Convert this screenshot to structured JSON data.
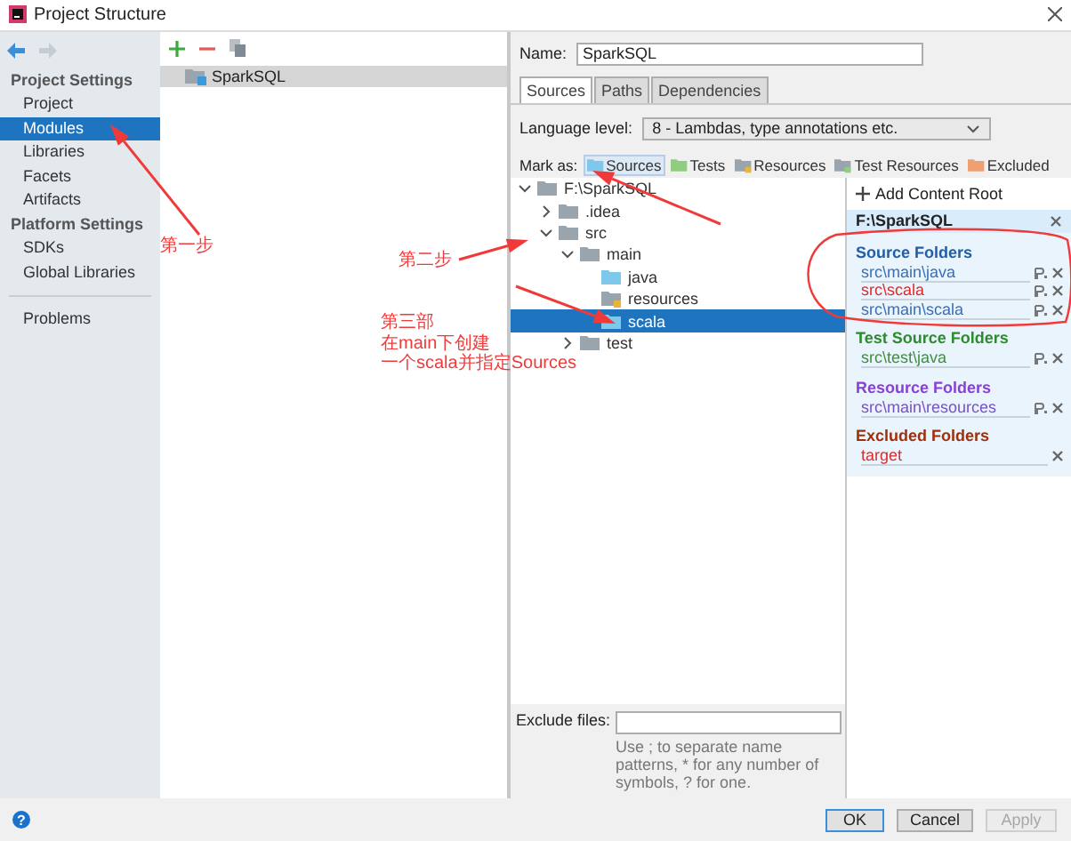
{
  "window": {
    "title": "Project Structure"
  },
  "sidebar": {
    "sections": [
      {
        "heading": "Project Settings",
        "items": [
          {
            "label": "Project",
            "selected": false
          },
          {
            "label": "Modules",
            "selected": true
          },
          {
            "label": "Libraries",
            "selected": false
          },
          {
            "label": "Facets",
            "selected": false
          },
          {
            "label": "Artifacts",
            "selected": false
          }
        ]
      },
      {
        "heading": "Platform Settings",
        "items": [
          {
            "label": "SDKs",
            "selected": false
          },
          {
            "label": "Global Libraries",
            "selected": false
          }
        ]
      }
    ],
    "footer_items": [
      {
        "label": "Problems",
        "selected": false
      }
    ]
  },
  "modules": {
    "items": [
      {
        "label": "SparkSQL",
        "selected": true
      }
    ]
  },
  "editor": {
    "name_label": "Name:",
    "name_value": "SparkSQL",
    "tabs": [
      {
        "label": "Sources",
        "selected": true
      },
      {
        "label": "Paths",
        "selected": false
      },
      {
        "label": "Dependencies",
        "selected": false
      }
    ],
    "language_level_label": "Language level:",
    "language_level_value": "8 - Lambdas, type annotations etc.",
    "mark_as_label": "Mark as:",
    "mark_buttons": [
      {
        "label": "Sources",
        "kind": "sources",
        "selected": true
      },
      {
        "label": "Tests",
        "kind": "tests",
        "selected": false
      },
      {
        "label": "Resources",
        "kind": "resources",
        "selected": false
      },
      {
        "label": "Test Resources",
        "kind": "test-resources",
        "selected": false
      },
      {
        "label": "Excluded",
        "kind": "excluded",
        "selected": false
      }
    ],
    "tree": [
      {
        "label": "F:\\SparkSQL",
        "kind": "plain",
        "expanded": true,
        "selected": false,
        "children": [
          {
            "label": ".idea",
            "kind": "plain",
            "expanded": false,
            "selected": false
          },
          {
            "label": "src",
            "kind": "plain",
            "expanded": true,
            "selected": false,
            "children": [
              {
                "label": "main",
                "kind": "plain",
                "expanded": true,
                "selected": false,
                "children": [
                  {
                    "label": "java",
                    "kind": "sources",
                    "selected": false
                  },
                  {
                    "label": "resources",
                    "kind": "resources",
                    "selected": false
                  },
                  {
                    "label": "scala",
                    "kind": "sources",
                    "selected": true
                  }
                ]
              },
              {
                "label": "test",
                "kind": "plain",
                "expanded": false,
                "selected": false
              }
            ]
          }
        ]
      }
    ],
    "content_roots": {
      "add_label": "Add Content Root",
      "root_path": "F:\\SparkSQL",
      "groups": [
        {
          "title": "Source Folders",
          "kind": "sources",
          "entries": [
            {
              "path": "src\\main\\java",
              "invalid": false
            },
            {
              "path": "src\\scala",
              "invalid": true
            },
            {
              "path": "src\\main\\scala",
              "invalid": false
            }
          ]
        },
        {
          "title": "Test Source Folders",
          "kind": "tests",
          "entries": [
            {
              "path": "src\\test\\java",
              "invalid": false
            }
          ]
        },
        {
          "title": "Resource Folders",
          "kind": "resources",
          "entries": [
            {
              "path": "src\\main\\resources",
              "invalid": false
            }
          ]
        },
        {
          "title": "Excluded Folders",
          "kind": "excluded",
          "entries": [
            {
              "path": "target",
              "invalid": true
            }
          ]
        }
      ]
    },
    "exclude_files_label": "Exclude files:",
    "exclude_hint": "Use ; to separate name patterns, * for any number of symbols, ? for one."
  },
  "footer": {
    "help_glyph": "?",
    "buttons": [
      {
        "label": "OK",
        "default": true,
        "disabled": false
      },
      {
        "label": "Cancel",
        "default": false,
        "disabled": false
      },
      {
        "label": "Apply",
        "default": false,
        "disabled": true
      }
    ]
  },
  "annotations": {
    "notes": [
      {
        "lines": [
          "第一步"
        ]
      },
      {
        "lines": [
          "第二步"
        ]
      },
      {
        "lines": [
          "第三部",
          "在main下创建",
          "一个scala并指定Sources"
        ]
      }
    ]
  }
}
